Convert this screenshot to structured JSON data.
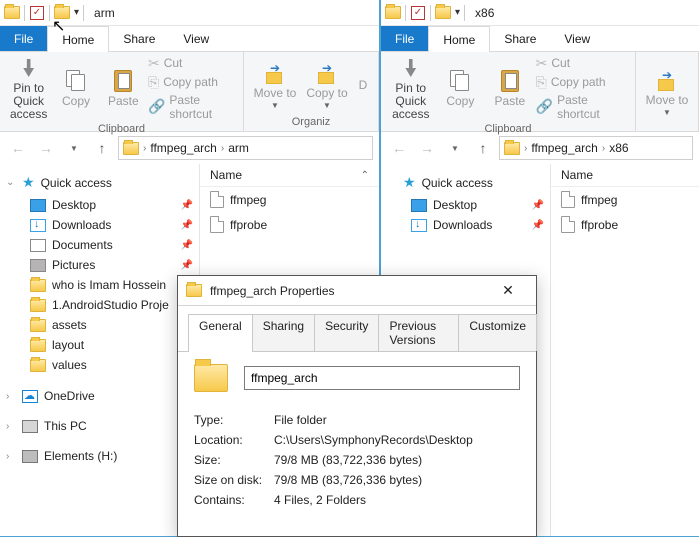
{
  "left": {
    "title": "arm",
    "tabs": {
      "file": "File",
      "home": "Home",
      "share": "Share",
      "view": "View"
    },
    "ribbon": {
      "pin": "Pin to Quick access",
      "copy": "Copy",
      "paste": "Paste",
      "cut": "Cut",
      "copy_path": "Copy path",
      "paste_shortcut": "Paste shortcut",
      "clipboard": "Clipboard",
      "move_to": "Move to",
      "copy_to": "Copy to",
      "delete_prefix": "D",
      "organize": "Organiz"
    },
    "breadcrumb": [
      "ffmpeg_arch",
      "arm"
    ],
    "list_header": "Name",
    "files": [
      "ffmpeg",
      "ffprobe"
    ]
  },
  "right": {
    "title": "x86",
    "tabs": {
      "file": "File",
      "home": "Home",
      "share": "Share",
      "view": "View"
    },
    "ribbon": {
      "pin": "Pin to Quick access",
      "copy": "Copy",
      "paste": "Paste",
      "cut": "Cut",
      "copy_path": "Copy path",
      "paste_shortcut": "Paste shortcut",
      "clipboard": "Clipboard",
      "move_to": "Move to"
    },
    "breadcrumb": [
      "ffmpeg_arch",
      "x86"
    ],
    "list_header": "Name",
    "files": [
      "ffmpeg",
      "ffprobe"
    ]
  },
  "nav_left": {
    "quick": "Quick access",
    "items": [
      "Desktop",
      "Downloads",
      "Documents",
      "Pictures",
      "who is Imam Hossein",
      "1.AndroidStudio Proje",
      "assets",
      "layout",
      "values"
    ],
    "onedrive": "OneDrive",
    "thispc": "This PC",
    "drive": "Elements (H:)"
  },
  "nav_right": {
    "quick": "Quick access",
    "items": [
      "Desktop",
      "Downloads"
    ]
  },
  "props": {
    "title": "ffmpeg_arch Properties",
    "tabs": [
      "General",
      "Sharing",
      "Security",
      "Previous Versions",
      "Customize"
    ],
    "name": "ffmpeg_arch",
    "rows": {
      "type_l": "Type:",
      "type_v": "File folder",
      "loc_l": "Location:",
      "loc_v": "C:\\Users\\SymphonyRecords\\Desktop",
      "size_l": "Size:",
      "size_v": "79/8 MB (83,722,336 bytes)",
      "sod_l": "Size on disk:",
      "sod_v": "79/8 MB (83,726,336 bytes)",
      "cont_l": "Contains:",
      "cont_v": "4 Files, 2 Folders"
    }
  }
}
